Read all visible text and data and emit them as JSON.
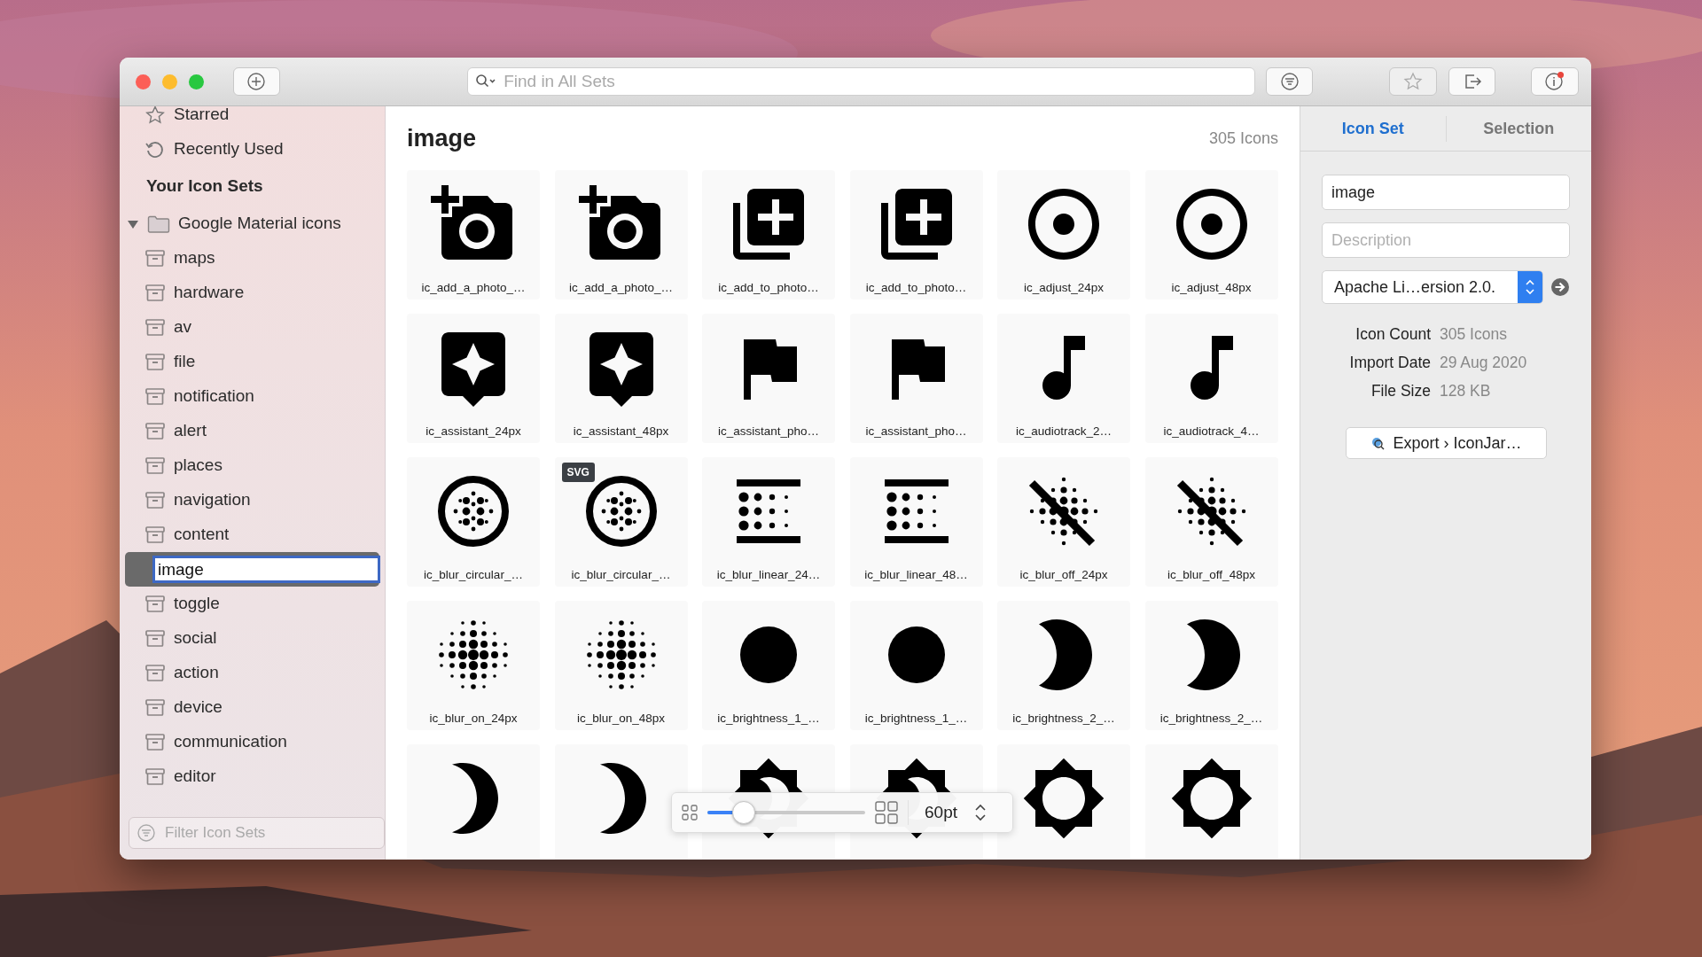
{
  "toolbar": {
    "search": {
      "placeholder": "Find in All Sets"
    }
  },
  "sidebar": {
    "items": [
      {
        "label": "Starred",
        "kind": "starred"
      },
      {
        "label": "Recently Used",
        "kind": "recent"
      }
    ],
    "section_title": "Your Icon Sets",
    "sets": [
      {
        "label": "Google Material icons",
        "expanded": true,
        "children": [
          {
            "label": "maps",
            "selected": false
          },
          {
            "label": "hardware",
            "selected": false
          },
          {
            "label": "av",
            "selected": false
          },
          {
            "label": "file",
            "selected": false
          },
          {
            "label": "notification",
            "selected": false
          },
          {
            "label": "alert",
            "selected": false
          },
          {
            "label": "places",
            "selected": false
          },
          {
            "label": "navigation",
            "selected": false
          },
          {
            "label": "content",
            "selected": false
          },
          {
            "label": "image",
            "selected": true
          },
          {
            "label": "toggle",
            "selected": false
          },
          {
            "label": "social",
            "selected": false
          },
          {
            "label": "action",
            "selected": false
          },
          {
            "label": "device",
            "selected": false
          },
          {
            "label": "communication",
            "selected": false
          },
          {
            "label": "editor",
            "selected": false
          }
        ]
      }
    ],
    "filter": {
      "placeholder": "Filter Icon Sets"
    }
  },
  "main": {
    "title": "image",
    "count": "305 Icons",
    "icons": [
      {
        "kind": "add-photo",
        "label": "ic_add_a_photo_…"
      },
      {
        "kind": "add-photo",
        "label": "ic_add_a_photo_…"
      },
      {
        "kind": "add-to-photos",
        "label": "ic_add_to_photo…"
      },
      {
        "kind": "add-to-photos",
        "label": "ic_add_to_photo…"
      },
      {
        "kind": "adjust",
        "label": "ic_adjust_24px"
      },
      {
        "kind": "adjust",
        "label": "ic_adjust_48px"
      },
      {
        "kind": "assistant",
        "label": "ic_assistant_24px"
      },
      {
        "kind": "assistant",
        "label": "ic_assistant_48px"
      },
      {
        "kind": "flag",
        "label": "ic_assistant_pho…"
      },
      {
        "kind": "flag",
        "label": "ic_assistant_pho…"
      },
      {
        "kind": "audiotrack",
        "label": "ic_audiotrack_2…"
      },
      {
        "kind": "audiotrack",
        "label": "ic_audiotrack_4…"
      },
      {
        "kind": "blur-circular",
        "label": "ic_blur_circular_…"
      },
      {
        "kind": "blur-circular",
        "label": "ic_blur_circular_…",
        "badge": "SVG"
      },
      {
        "kind": "blur-linear",
        "label": "ic_blur_linear_24…"
      },
      {
        "kind": "blur-linear",
        "label": "ic_blur_linear_48…"
      },
      {
        "kind": "blur-off",
        "label": "ic_blur_off_24px"
      },
      {
        "kind": "blur-off",
        "label": "ic_blur_off_48px"
      },
      {
        "kind": "blur-on",
        "label": "ic_blur_on_24px"
      },
      {
        "kind": "blur-on",
        "label": "ic_blur_on_48px"
      },
      {
        "kind": "brightness-1",
        "label": "ic_brightness_1_…"
      },
      {
        "kind": "brightness-1",
        "label": "ic_brightness_1_…"
      },
      {
        "kind": "brightness-2",
        "label": "ic_brightness_2_…"
      },
      {
        "kind": "brightness-2",
        "label": "ic_brightness_2_…"
      },
      {
        "kind": "brightness-3"
      },
      {
        "kind": "brightness-3"
      },
      {
        "kind": "brightness-4"
      },
      {
        "kind": "brightness-4"
      },
      {
        "kind": "brightness-5"
      },
      {
        "kind": "brightness-5"
      }
    ],
    "zoom": {
      "level": 0.23,
      "size": "60pt"
    }
  },
  "inspector": {
    "tabs": [
      {
        "label": "Icon Set",
        "selected": true
      },
      {
        "label": "Selection",
        "selected": false
      }
    ],
    "name": {
      "value": "image"
    },
    "description": {
      "placeholder": "Description"
    },
    "license": {
      "value": "Apache Li…ersion 2.0."
    },
    "info": [
      {
        "label": "Icon Count",
        "value": "305 Icons"
      },
      {
        "label": "Import Date",
        "value": "29 Aug 2020"
      },
      {
        "label": "File Size",
        "value": "128 KB"
      }
    ],
    "export": {
      "label": "Export",
      "separator": "›",
      "target": "IconJar…"
    }
  }
}
